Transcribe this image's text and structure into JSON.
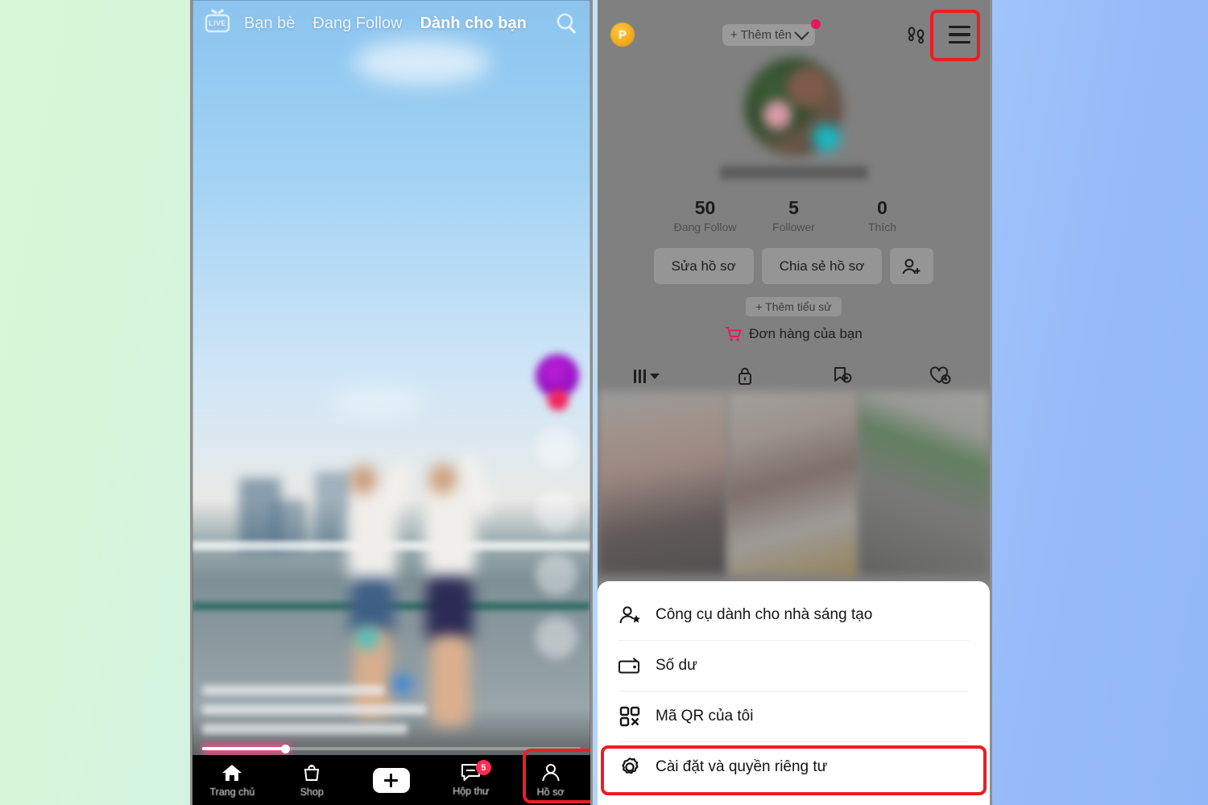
{
  "theme": {
    "accent_red": "#ee1c24",
    "tiktok_pink": "#fe2c55",
    "tiktok_cyan": "#25f4ee",
    "badge_gold": "#f0a81c",
    "verified_teal": "#16b8c4",
    "bg_gradient_from": "#d8f7d6",
    "bg_gradient_to": "#92b7f8"
  },
  "left_phone": {
    "top_nav": {
      "live_label": "LIVE",
      "tabs": [
        {
          "label": "Bạn bè",
          "active": false
        },
        {
          "label": "Đang Follow",
          "active": false
        },
        {
          "label": "Dành cho bạn",
          "active": true
        }
      ],
      "search_icon": "search-icon"
    },
    "bottom_nav": {
      "items": [
        {
          "label": "Trang chủ",
          "icon": "home-icon",
          "badge": "",
          "highlighted": false
        },
        {
          "label": "Shop",
          "icon": "shop-bag-icon",
          "badge": "",
          "highlighted": false
        },
        {
          "label": "",
          "icon": "create-plus-icon",
          "badge": "",
          "highlighted": false
        },
        {
          "label": "Hộp thư",
          "icon": "message-icon",
          "badge": "5",
          "highlighted": false
        },
        {
          "label": "Hồ sơ",
          "icon": "person-icon",
          "badge": "",
          "highlighted": true
        }
      ]
    }
  },
  "right_phone": {
    "header": {
      "pro_badge_label": "P",
      "add_name_label": "+ Thêm tên",
      "chevron_icon": "chevron-down-icon",
      "notification_dot": true,
      "footsteps_icon": "footsteps-icon",
      "menu_icon": "hamburger-menu-icon",
      "menu_highlighted": true
    },
    "profile": {
      "avatar_icon": "profile-avatar",
      "verified_badge_icon": "verified-badge-icon",
      "username": "",
      "stats": [
        {
          "value": "50",
          "label": "Đang Follow"
        },
        {
          "value": "5",
          "label": "Follower"
        },
        {
          "value": "0",
          "label": "Thích"
        }
      ],
      "edit_profile_label": "Sửa hồ sơ",
      "share_profile_label": "Chia sẻ hồ sơ",
      "add_friend_icon": "add-person-icon",
      "add_bio_label": "+ Thêm tiểu sử",
      "orders_label": "Đơn hàng của bạn",
      "orders_icon": "shopping-cart-icon",
      "tabs": [
        {
          "icon": "grid-sort-icon",
          "has_caret": true
        },
        {
          "icon": "lock-icon",
          "has_caret": false
        },
        {
          "icon": "private-bookmark-icon",
          "has_caret": false
        },
        {
          "icon": "private-heart-icon",
          "has_caret": false
        }
      ]
    },
    "bottom_sheet": {
      "items": [
        {
          "label": "Công cụ dành cho nhà sáng tạo",
          "icon": "creator-tools-icon",
          "highlighted": false
        },
        {
          "label": "Số dư",
          "icon": "wallet-icon",
          "highlighted": false
        },
        {
          "label": "Mã QR của tôi",
          "icon": "qr-code-icon",
          "highlighted": false
        },
        {
          "label": "Cài đặt và quyền riêng tư",
          "icon": "gear-icon",
          "highlighted": true
        }
      ]
    }
  }
}
